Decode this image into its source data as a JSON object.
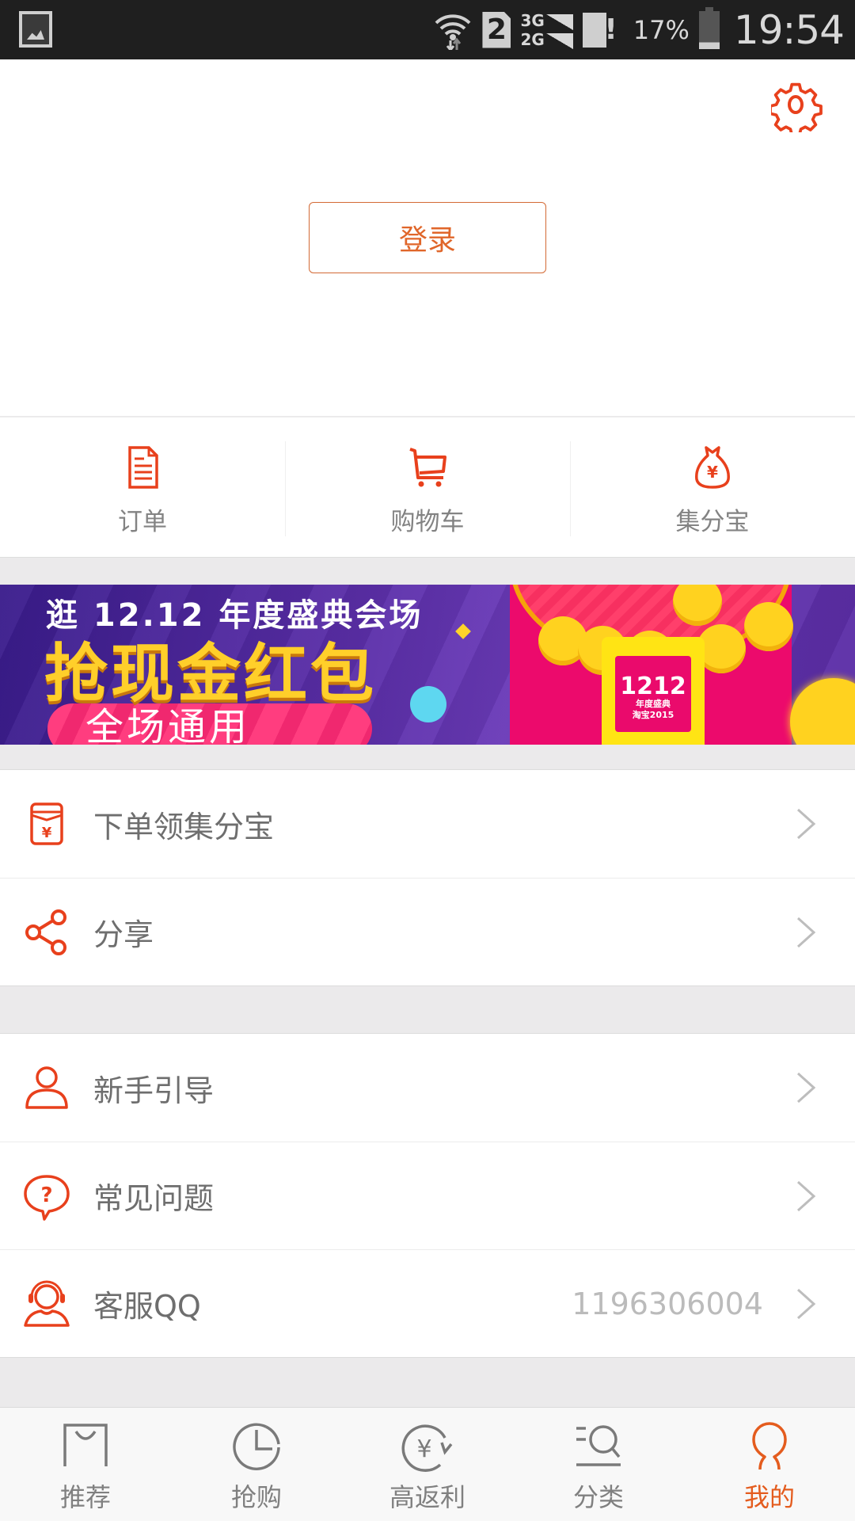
{
  "status_bar": {
    "time": "19:54",
    "battery_percent": "17%",
    "sim_slot": "2",
    "network_top": "3G",
    "network_bottom": "2G",
    "icons": [
      "gallery-notification-icon",
      "wifi-icon",
      "sim2-icon",
      "signal-icon",
      "sim-card-alert-icon",
      "battery-icon"
    ]
  },
  "header": {
    "settings_icon": "gear-icon",
    "login_label": "登录"
  },
  "quick_actions": [
    {
      "label": "订单",
      "icon": "document-icon"
    },
    {
      "label": "购物车",
      "icon": "cart-icon"
    },
    {
      "label": "集分宝",
      "icon": "money-bag-icon"
    }
  ],
  "banner": {
    "line1": "逛 12.12 年度盛典会场",
    "line2": "抢现金红包",
    "line3": "全场通用",
    "badge_number": "1212",
    "badge_text": "年度盛典",
    "badge_sub": "淘宝2015"
  },
  "menu_group1": [
    {
      "label": "下单领集分宝",
      "icon": "red-envelope-icon",
      "value": ""
    },
    {
      "label": "分享",
      "icon": "share-icon",
      "value": ""
    }
  ],
  "menu_group2": [
    {
      "label": "新手引导",
      "icon": "user-icon",
      "value": ""
    },
    {
      "label": "常见问题",
      "icon": "question-bubble-icon",
      "value": ""
    },
    {
      "label": "客服QQ",
      "icon": "headset-icon",
      "value": "1196306004"
    }
  ],
  "tabbar": {
    "active_index": 4,
    "tabs": [
      {
        "label": "推荐",
        "icon": "shopping-bag-icon"
      },
      {
        "label": "抢购",
        "icon": "clock-icon"
      },
      {
        "label": "高返利",
        "icon": "yen-rebate-icon"
      },
      {
        "label": "分类",
        "icon": "category-search-icon"
      },
      {
        "label": "我的",
        "icon": "profile-icon"
      }
    ]
  },
  "colors": {
    "accent": "#e45c1e",
    "icon_red": "#e8401c",
    "text_gray": "#6e6e6e",
    "value_gray": "#bbbbbb",
    "background": "#ebeaeb"
  }
}
